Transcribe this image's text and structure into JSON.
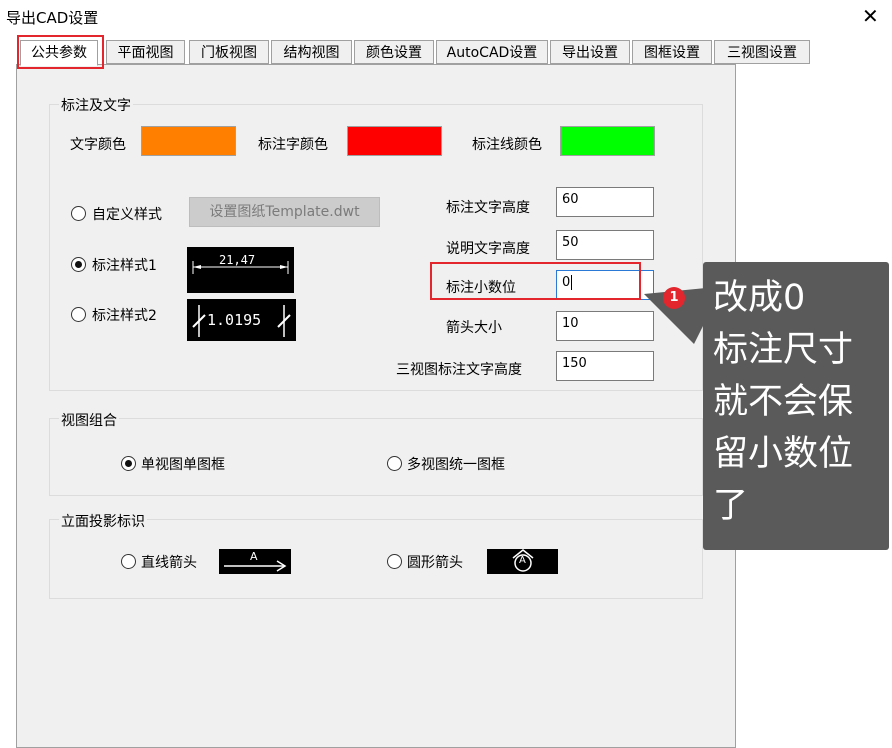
{
  "window": {
    "title": "导出CAD设置",
    "close_glyph": "✕"
  },
  "tabs": [
    {
      "label": "公共参数",
      "active": true
    },
    {
      "label": "平面视图"
    },
    {
      "label": "门板视图"
    },
    {
      "label": "结构视图"
    },
    {
      "label": "颜色设置"
    },
    {
      "label": "AutoCAD设置"
    },
    {
      "label": "导出设置"
    },
    {
      "label": "图框设置"
    },
    {
      "label": "三视图设置"
    }
  ],
  "annotation_group": {
    "title": "标注及文字",
    "text_color_label": "文字颜色",
    "text_color": "#ff8000",
    "dim_text_color_label": "标注字颜色",
    "dim_text_color": "#ff0000",
    "dim_line_color_label": "标注线颜色",
    "dim_line_color": "#00ff00",
    "custom_style_label": "自定义样式",
    "template_button": "设置图纸Template.dwt",
    "style1_label": "标注样式1",
    "style1_preview": "21,47",
    "style2_label": "标注样式2",
    "style2_preview": "1.0195",
    "fields": [
      {
        "label": "标注文字高度",
        "value": "60"
      },
      {
        "label": "说明文字高度",
        "value": "50"
      },
      {
        "label": "标注小数位",
        "value": "0"
      },
      {
        "label": "箭头大小",
        "value": "10"
      },
      {
        "label": "三视图标注文字高度",
        "value": "150"
      }
    ]
  },
  "view_group": {
    "title": "视图组合",
    "option1": "单视图单图框",
    "option2": "多视图统一图框"
  },
  "elevation_group": {
    "title": "立面投影标识",
    "option1": "直线箭头",
    "option2": "圆形箭头",
    "symbol_letter": "A"
  },
  "callout": {
    "badge": "1",
    "lines": [
      "改成0",
      "标注尺寸",
      "就不会保",
      "留小数位",
      "了"
    ]
  }
}
